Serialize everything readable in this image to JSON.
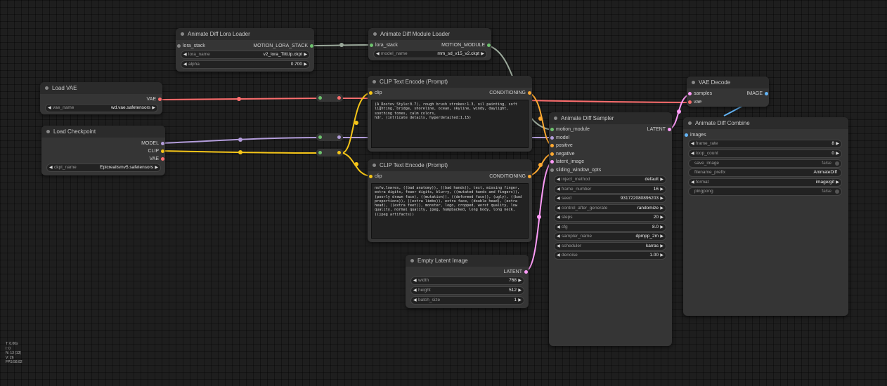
{
  "colors": {
    "clip": "#f5c518",
    "model": "#b39ddb",
    "vae": "#ff6e6e",
    "latent": "#ff9cf9",
    "conditioning": "#ffa931",
    "image": "#64b5f6",
    "lora_stack": "#9e9e9e",
    "motion_module": "#9e9e9e",
    "neutral": "#888888"
  },
  "nodes": {
    "lora_loader": {
      "title": "Animate Diff Lora Loader",
      "in_lora_stack": "lora_stack",
      "out_motion_lora_stack": "MOTION_LORA_STACK",
      "w_lora_name_label": "lora_name",
      "w_lora_name_value": "v2_lora_TiltUp.ckpt",
      "w_alpha_label": "alpha",
      "w_alpha_value": "0.700"
    },
    "module_loader": {
      "title": "Animate Diff Module Loader",
      "in_lora_stack": "lora_stack",
      "out_motion_module": "MOTION_MODULE",
      "w_model_name_label": "model_name",
      "w_model_name_value": "mm_sd_v15_v2.ckpt"
    },
    "load_vae": {
      "title": "Load VAE",
      "out_vae": "VAE",
      "w_vae_name_label": "vae_name",
      "w_vae_name_value": "wd.vae.safetensors"
    },
    "load_checkpoint": {
      "title": "Load Checkpoint",
      "out_model": "MODEL",
      "out_clip": "CLIP",
      "out_vae": "VAE",
      "w_ckpt_name_label": "ckpt_name",
      "w_ckpt_name_value": "Epicrealismv5.safetensors"
    },
    "clip_pos": {
      "title": "CLIP Text Encode (Prompt)",
      "in_clip": "clip",
      "out_conditioning": "CONDITIONING",
      "text": "(A_Rostov_Style:0.7), rough brush strokes:1.3, oil painting, soft lighting, bridge, shoreline, ocean, skyline, windy, daylight, soothing tones, calm colors,\nhdr, (intricate details, hyperdetailed:1.15)"
    },
    "clip_neg": {
      "title": "CLIP Text Encode (Prompt)",
      "in_clip": "clip",
      "out_conditioning": "CONDITIONING",
      "text": "nsfw,lowres, ((bad anatomy)), ((bad hands)), text, missing finger, extra digits, fewer digits, blurry, ((mutated hands and fingers)), (poorly drawn face), ((mutation)), ((deformed face)), (ugly), ((bad proportions)), ((extra limbs)), extra face, (double head), (extra head), ((extra feet)), monster, logo, cropped, worst quality, low quality, normal quality, jpeg, humpbacked, long body, long neck, ((jpeg artifacts))"
    },
    "empty_latent": {
      "title": "Empty Latent Image",
      "out_latent": "LATENT",
      "w_width_label": "width",
      "w_width_value": "768",
      "w_height_label": "height",
      "w_height_value": "512",
      "w_batch_label": "batch_size",
      "w_batch_value": "1"
    },
    "sampler": {
      "title": "Animate Diff Sampler",
      "in_motion_module": "motion_module",
      "in_model": "model",
      "in_positive": "positive",
      "in_negative": "negative",
      "in_latent_image": "latent_image",
      "in_sliding_window_opts": "sliding_window_opts",
      "out_latent": "LATENT",
      "widgets": [
        {
          "label": "inject_method",
          "value": "default"
        },
        {
          "label": "frame_number",
          "value": "16"
        },
        {
          "label": "seed",
          "value": "931722080896203"
        },
        {
          "label": "control_after_generate",
          "value": "randomize"
        },
        {
          "label": "steps",
          "value": "20"
        },
        {
          "label": "cfg",
          "value": "8.0"
        },
        {
          "label": "sampler_name",
          "value": "dpmpp_2m"
        },
        {
          "label": "scheduler",
          "value": "karras"
        },
        {
          "label": "denoise",
          "value": "1.00"
        }
      ]
    },
    "vae_decode": {
      "title": "VAE Decode",
      "in_samples": "samples",
      "in_vae": "vae",
      "out_image": "IMAGE"
    },
    "combine": {
      "title": "Animate Diff Combine",
      "in_images": "images",
      "w_frame_rate_label": "frame_rate",
      "w_frame_rate_value": "8",
      "w_loop_count_label": "loop_count",
      "w_loop_count_value": "0",
      "w_save_image_label": "save_image",
      "w_save_image_value": "false",
      "w_filename_prefix_label": "filename_prefix",
      "w_filename_prefix_value": "AnimateDiff",
      "w_format_label": "format",
      "w_format_value": "image/gif",
      "w_pingpong_label": "pingpong",
      "w_pingpong_value": "false"
    }
  },
  "stats": {
    "t": "T: 0.00s",
    "i": "I: 0",
    "n": "N: 13 [13]",
    "v": "V: 26",
    "fps": "FPS:58.82"
  }
}
